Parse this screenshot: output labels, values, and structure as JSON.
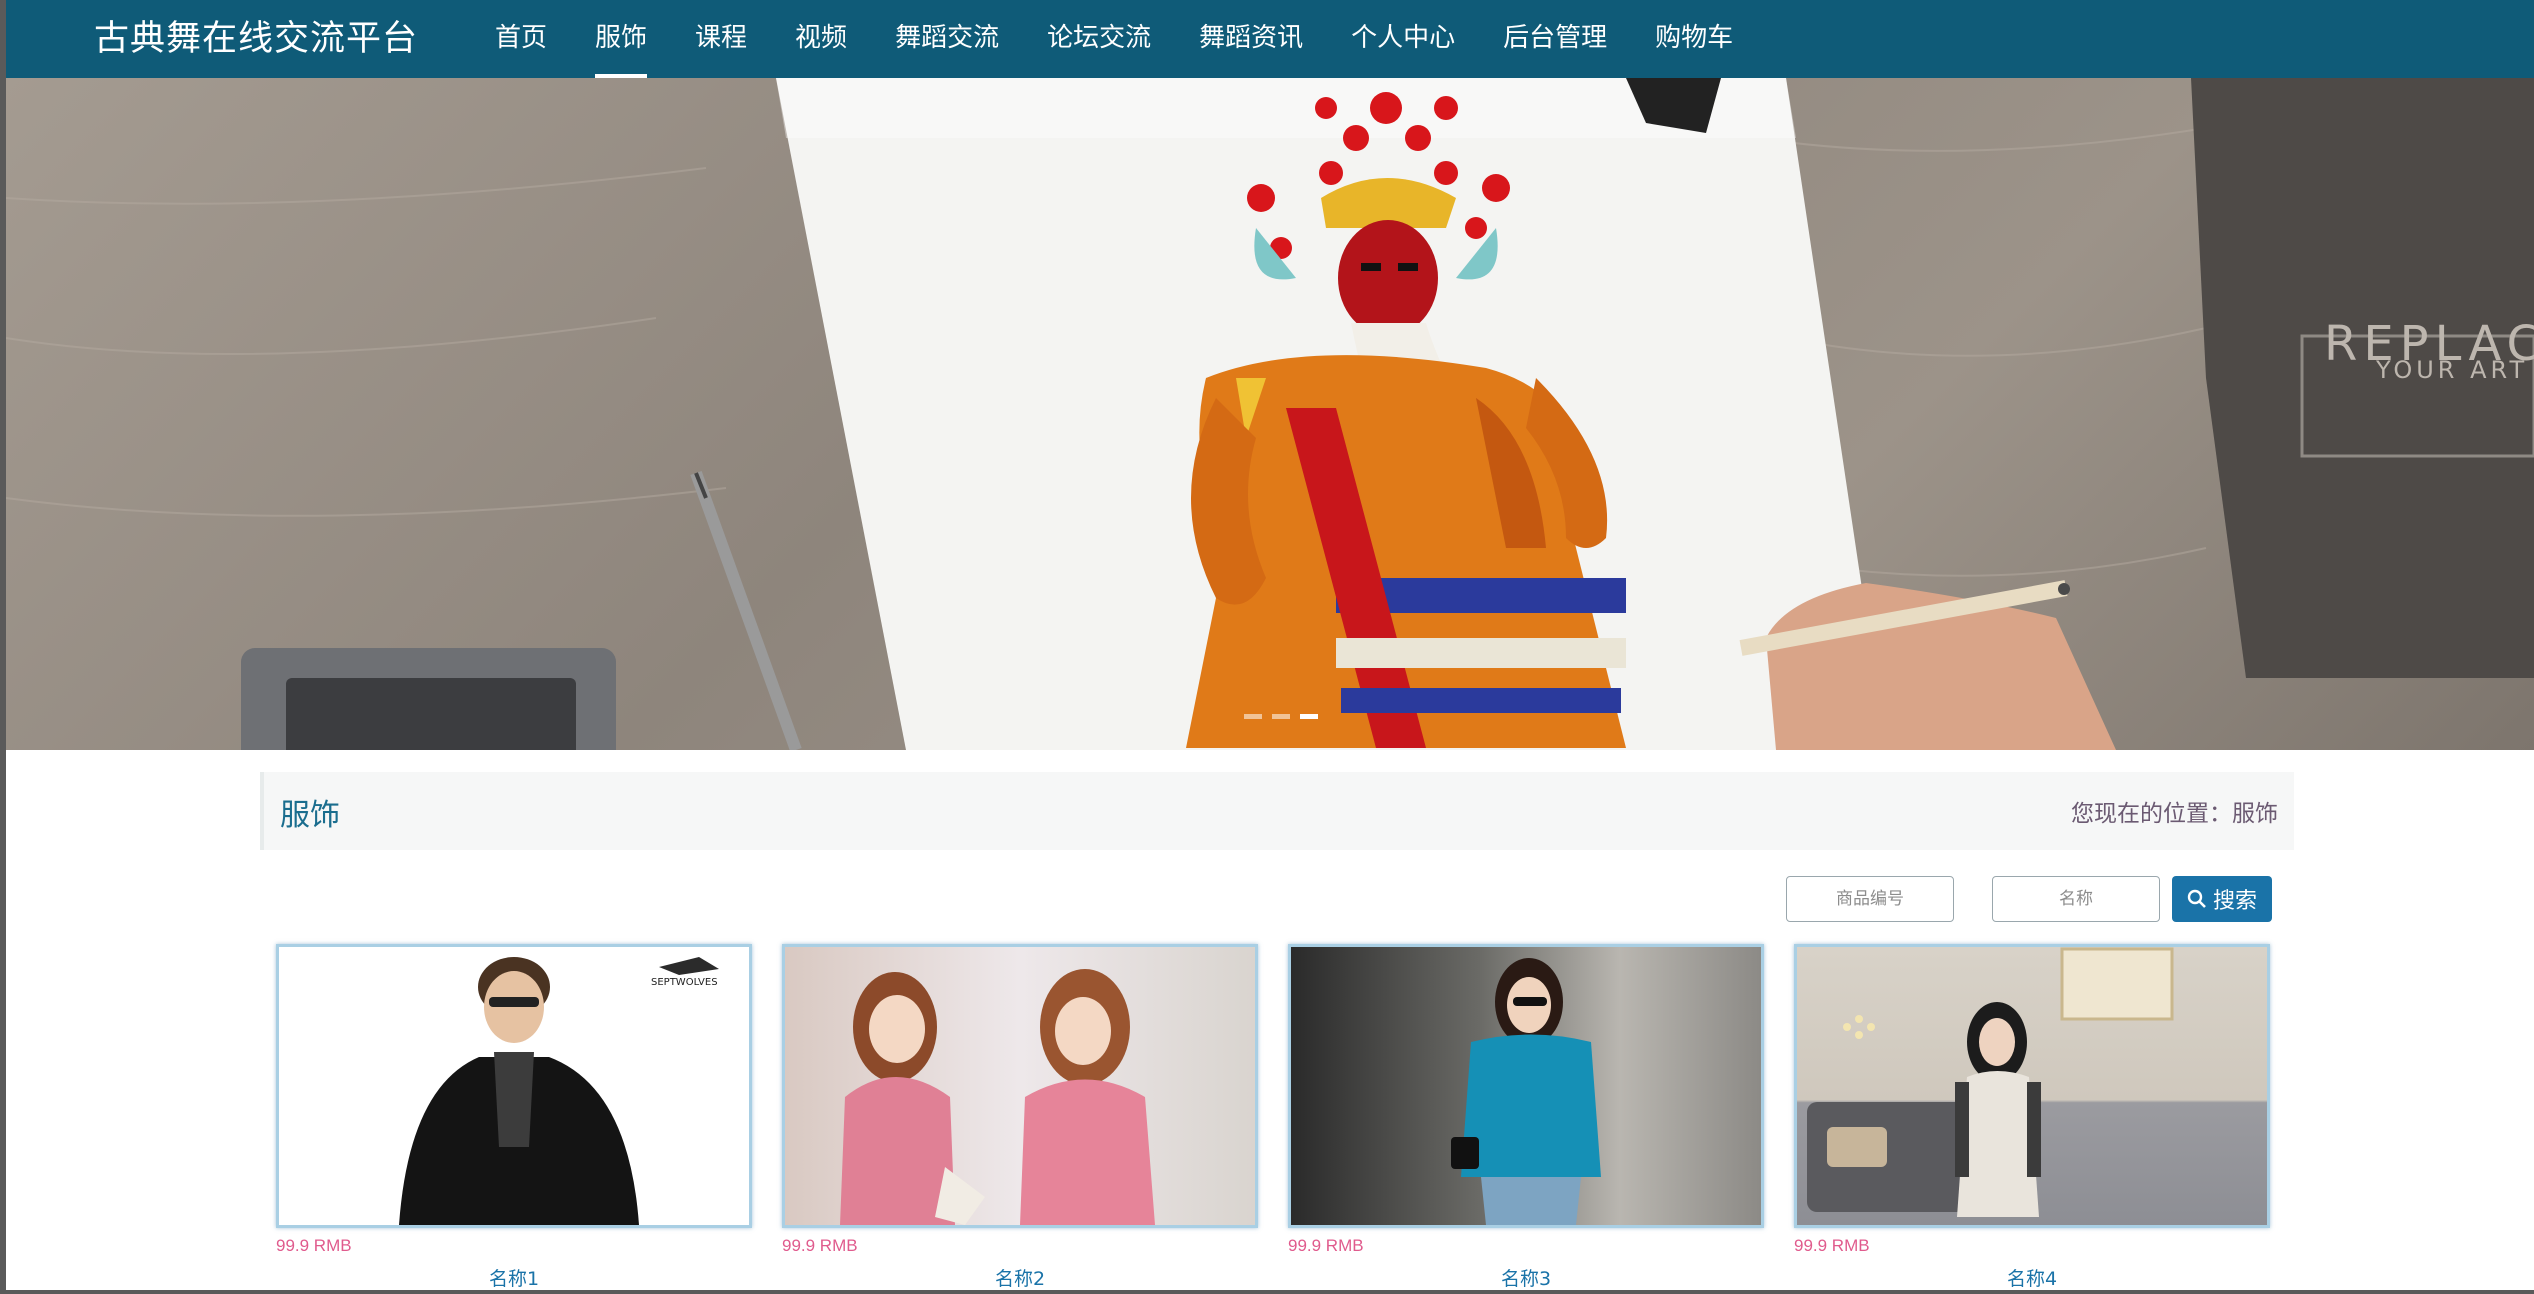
{
  "brand": "古典舞在线交流平台",
  "nav": {
    "items": [
      {
        "label": "首页",
        "name": "nav-item-home"
      },
      {
        "label": "服饰",
        "name": "nav-item-clothing"
      },
      {
        "label": "课程",
        "name": "nav-item-courses"
      },
      {
        "label": "视频",
        "name": "nav-item-videos"
      },
      {
        "label": "舞蹈交流",
        "name": "nav-item-dance-exchange"
      },
      {
        "label": "论坛交流",
        "name": "nav-item-forum"
      },
      {
        "label": "舞蹈资讯",
        "name": "nav-item-dance-news"
      },
      {
        "label": "个人中心",
        "name": "nav-item-personal-center"
      },
      {
        "label": "后台管理",
        "name": "nav-item-admin"
      },
      {
        "label": "购物车",
        "name": "nav-item-cart"
      }
    ],
    "active_index": 1
  },
  "banner": {
    "slide_count": 3,
    "active_slide": 2,
    "notebook_text_line1": "REPLAC",
    "notebook_text_line2": "YOUR ART",
    "logo_text": "SEPTWOLVES"
  },
  "section": {
    "title": "服饰",
    "breadcrumb": "您现在的位置：服饰"
  },
  "search": {
    "code_placeholder": "商品编号",
    "name_placeholder": "名称",
    "button_label": "搜索"
  },
  "products": [
    {
      "price": "99.9 RMB",
      "name": "名称1"
    },
    {
      "price": "99.9 RMB",
      "name": "名称2"
    },
    {
      "price": "99.9 RMB",
      "name": "名称3"
    },
    {
      "price": "99.9 RMB",
      "name": "名称4"
    }
  ],
  "colors": {
    "navbar": "#0f5b78",
    "accent": "#1a73a8",
    "price": "#e05b8d"
  }
}
